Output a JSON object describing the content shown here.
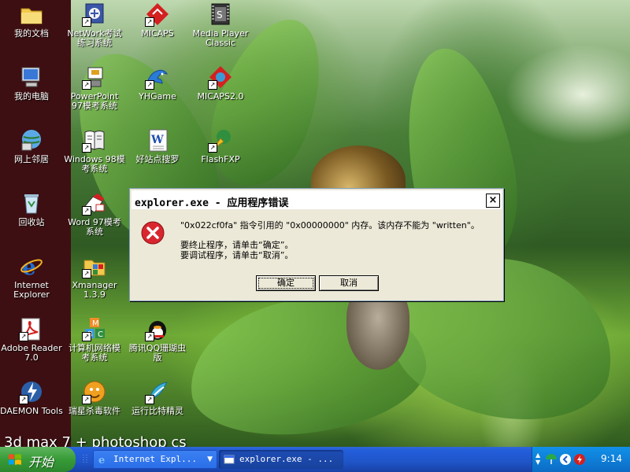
{
  "desktop": {
    "icons": [
      {
        "label": "我的文档"
      },
      {
        "label": "NetWork考试\n练习系统"
      },
      {
        "label": "MICAPS"
      },
      {
        "label": "Media Player\nClassic"
      },
      {
        "label": "我的电脑"
      },
      {
        "label": "PowerPoint\n97模考系统"
      },
      {
        "label": "YHGame"
      },
      {
        "label": "MICAPS2.0"
      },
      {
        "label": "网上邻居"
      },
      {
        "label": "Windows 98模\n考系统"
      },
      {
        "label": "好站点搜罗"
      },
      {
        "label": "FlashFXP"
      },
      {
        "label": "回收站"
      },
      {
        "label": "Word 97模考\n系统"
      },
      {
        "label": "Internet\nExplorer"
      },
      {
        "label": "Xmanager\n1.3.9"
      },
      {
        "label": "Adobe Reader\n7.0"
      },
      {
        "label": "计算机网络模\n考系统"
      },
      {
        "label": "腾讯QQ珊瑚虫\n版"
      },
      {
        "label": "DAEMON Tools"
      },
      {
        "label": "瑞星杀毒软件"
      },
      {
        "label": "运行比特精灵"
      }
    ],
    "wallpaper_caption": "3d max 7 + photoshop cs"
  },
  "dialog": {
    "title": "explorer.exe - 应用程序错误",
    "message": "\"0x022cf0fa\" 指令引用的 \"0x00000000\" 内存。该内存不能为 \"written\"。",
    "hint_terminate": "要终止程序，请单击“确定”。",
    "hint_debug": "要调试程序，请单击“取消”。",
    "ok_label": "确定",
    "cancel_label": "取消",
    "close_glyph": "×"
  },
  "taskbar": {
    "start_label": "开始",
    "items": [
      {
        "label": "Internet Expl...",
        "dropdown": "▼"
      },
      {
        "label": "explorer.exe - ..."
      }
    ],
    "tray_scroll_up": "▲",
    "tray_scroll_down": "▼",
    "clock": "9:14"
  },
  "colors": {
    "taskbar_blue": "#245edb",
    "start_green": "#379b37",
    "dialog_bg": "#ece9d8",
    "error_red": "#d9262e"
  }
}
